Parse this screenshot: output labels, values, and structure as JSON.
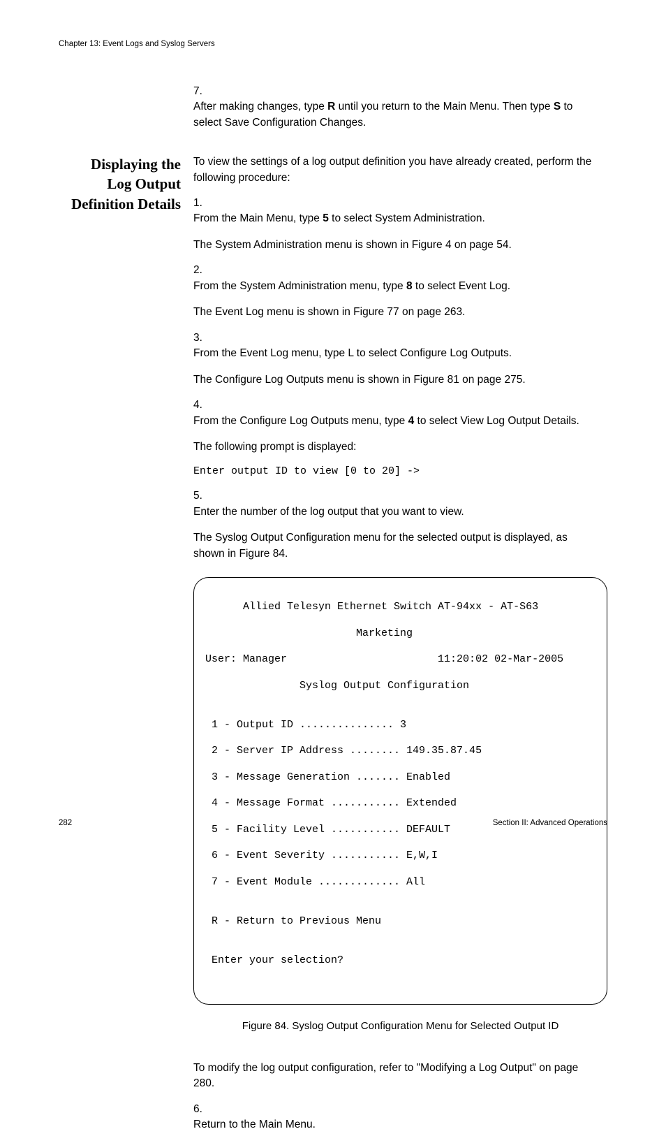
{
  "chapter_header": "Chapter 13: Event Logs and Syslog Servers",
  "step7_prefix": "7.",
  "step7_part_a": "After making changes, type ",
  "step7_bold_r": "R",
  "step7_part_b": " until you return to the Main Menu. Then type ",
  "step7_bold_s": "S",
  "step7_part_c": " to select Save Configuration Changes.",
  "side_heading_1": "Displaying the",
  "side_heading_2": "Log Output",
  "side_heading_3": "Definition Details",
  "intro": "To view the settings of a log output definition you have already created, perform the following procedure:",
  "s1_num": "1.",
  "s1_a": "From the Main Menu, type ",
  "s1_bold": "5",
  "s1_b": " to select System Administration.",
  "s1_sub": "The System Administration menu is shown in Figure 4 on page 54.",
  "s2_num": "2.",
  "s2_a": "From the System Administration menu, type ",
  "s2_bold": "8",
  "s2_b": " to select Event Log.",
  "s2_sub": "The Event Log menu is shown in Figure 77 on page 263.",
  "s3_num": "3.",
  "s3_text": "From the Event Log menu, type L to select Configure Log Outputs.",
  "s3_sub": "The Configure Log Outputs menu is shown in Figure 81 on page 275.",
  "s4_num": "4.",
  "s4_a": "From the Configure Log Outputs menu, type ",
  "s4_bold": "4",
  "s4_b": " to select View Log Output Details.",
  "s4_sub": "The following prompt is displayed:",
  "s4_code": "Enter output ID to view [0 to 20] ->",
  "s5_num": "5.",
  "s5_text": "Enter the number of the log output that you want to view.",
  "s5_sub": "The Syslog Output Configuration menu for the selected output is displayed, as shown in Figure 84.",
  "term_l1": "      Allied Telesyn Ethernet Switch AT-94xx - AT-S63",
  "term_l2": "                        Marketing",
  "term_l3": "User: Manager                        11:20:02 02-Mar-2005",
  "term_l4": "               Syslog Output Configuration",
  "term_l5": "",
  "term_l6": " 1 - Output ID ............... 3",
  "term_l7": " 2 - Server IP Address ........ 149.35.87.45",
  "term_l8": " 3 - Message Generation ....... Enabled",
  "term_l9": " 4 - Message Format ........... Extended",
  "term_l10": " 5 - Facility Level ........... DEFAULT",
  "term_l11": " 6 - Event Severity ........... E,W,I",
  "term_l12": " 7 - Event Module ............. All",
  "term_l13": "",
  "term_l14": " R - Return to Previous Menu",
  "term_l15": "",
  "term_l16": " Enter your selection?",
  "figure_caption": "Figure 84. Syslog Output Configuration Menu for Selected Output ID",
  "s5_post": "To modify the log output configuration, refer to \"Modifying a Log Output\" on page 280.",
  "s6_num": "6.",
  "s6_text": "Return to the Main Menu.",
  "page_num": "282",
  "section_label": "Section II: Advanced Operations"
}
